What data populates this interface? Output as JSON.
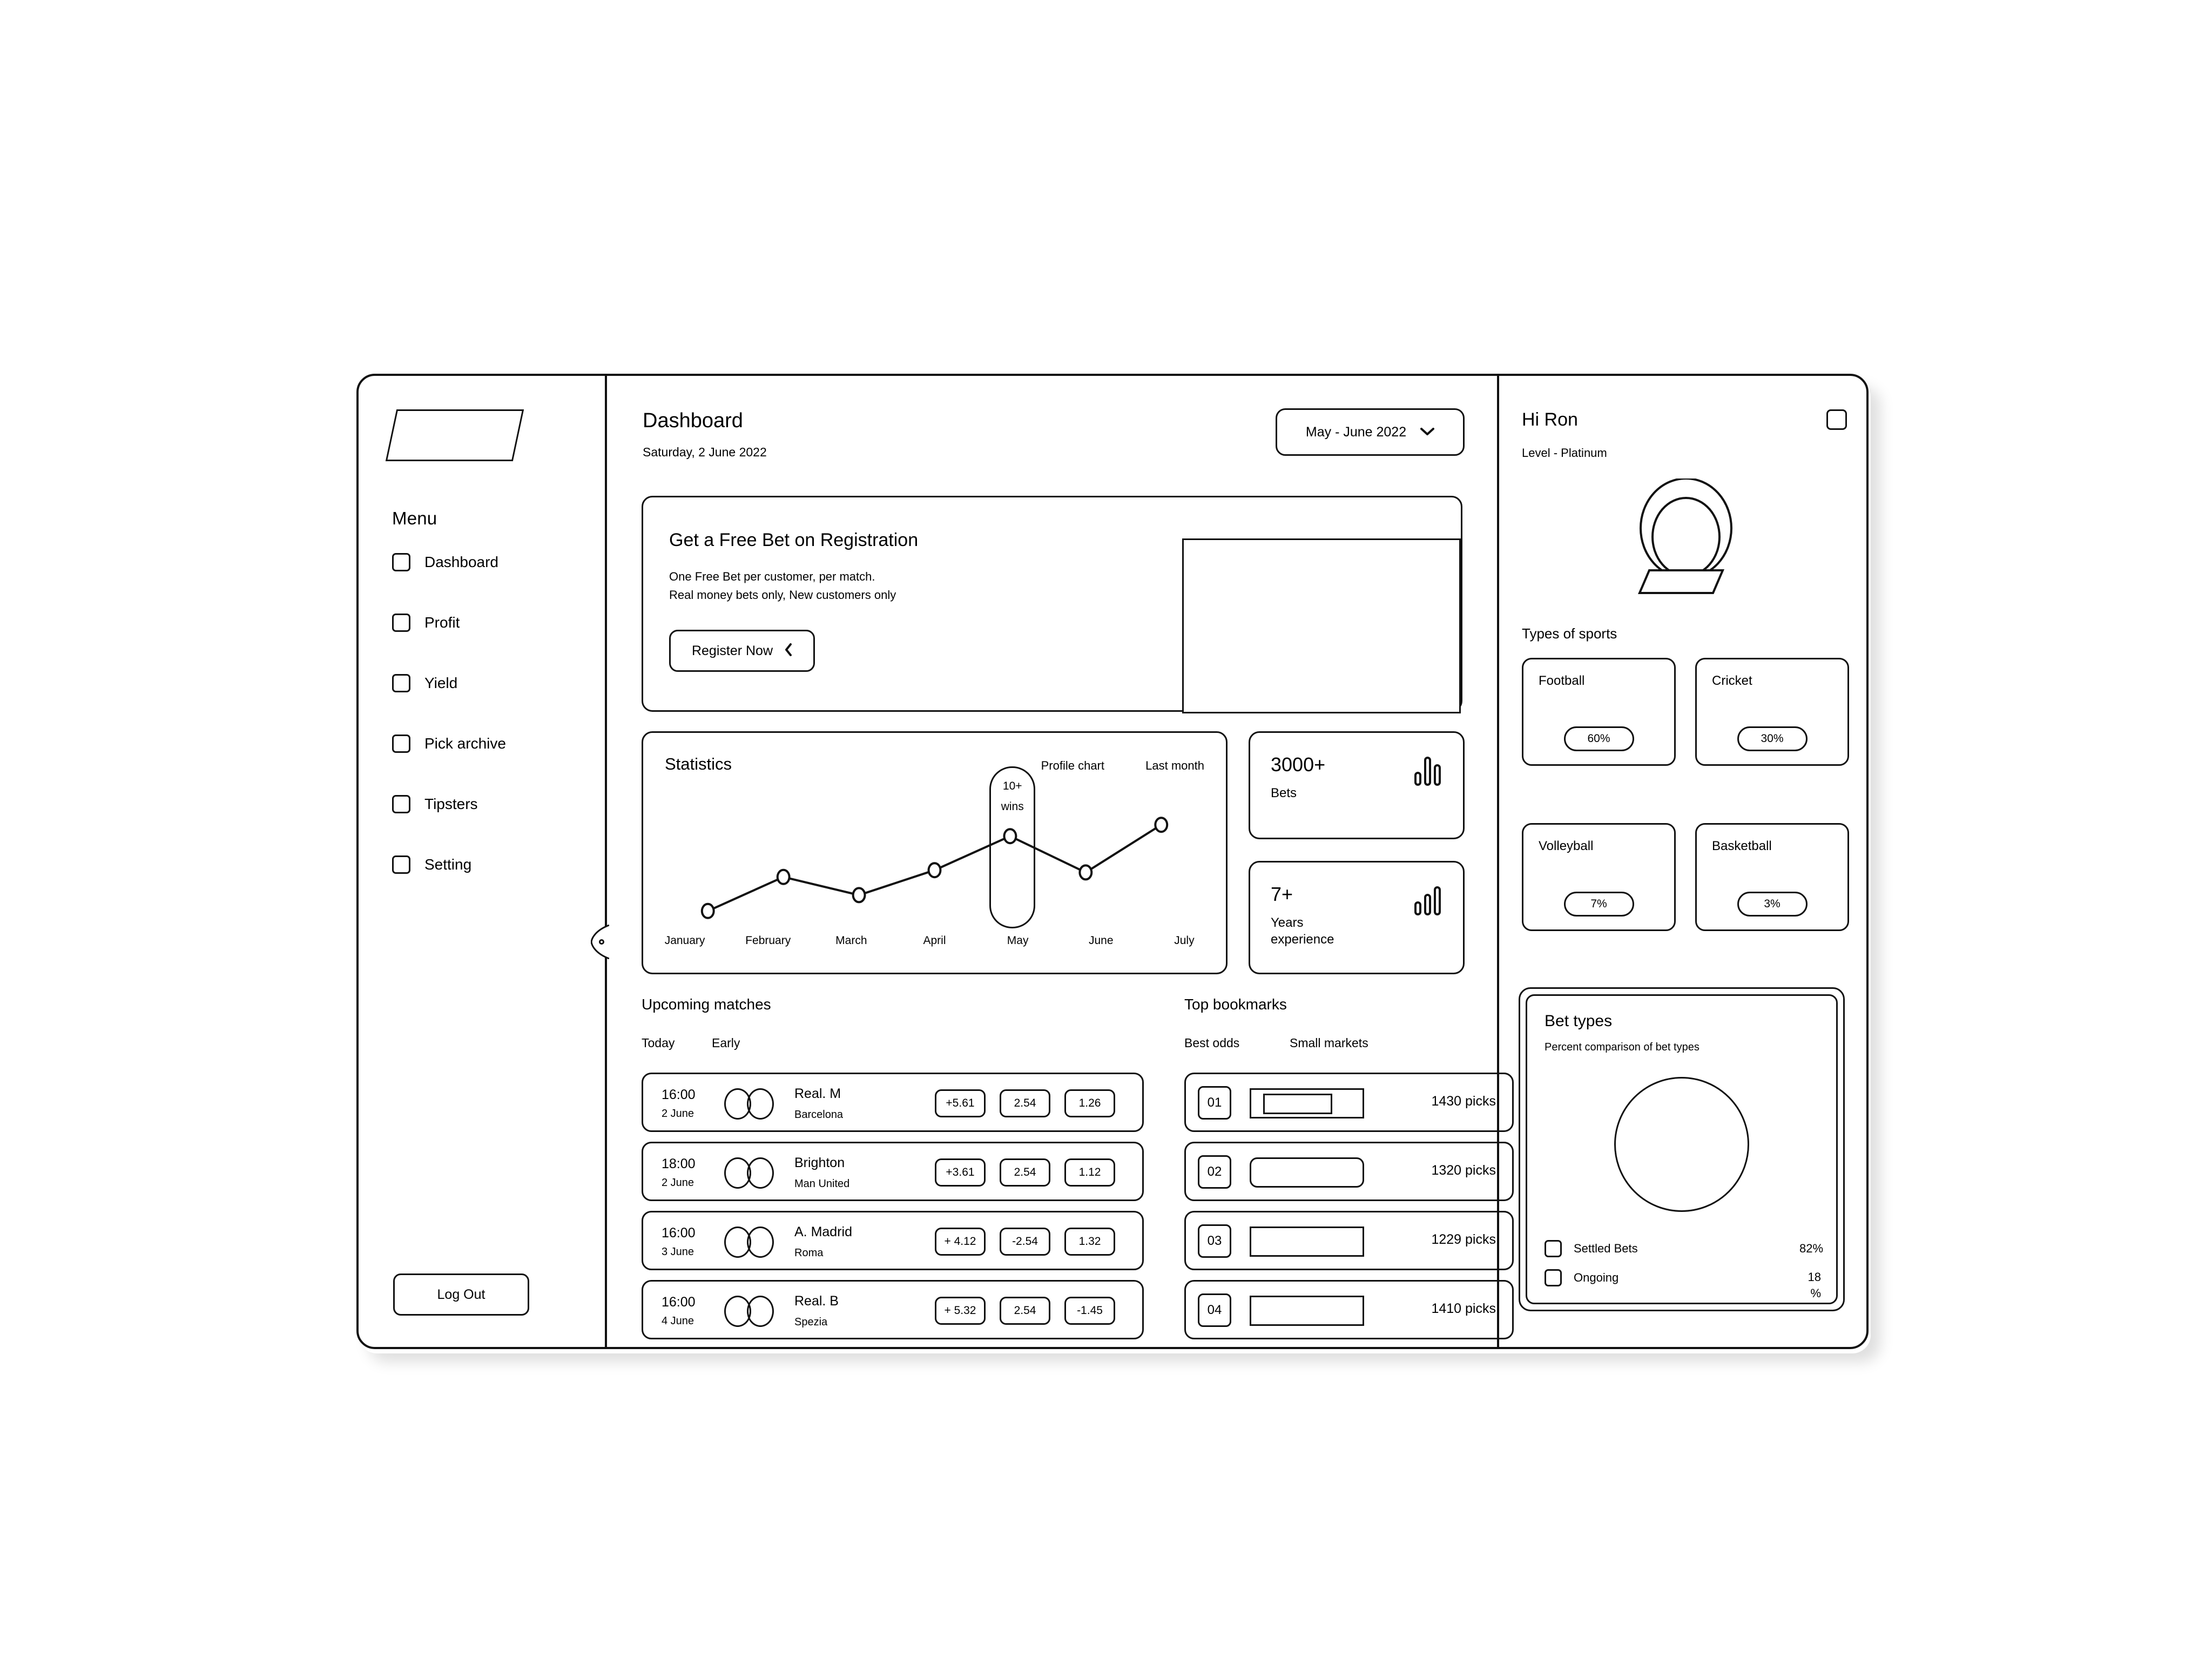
{
  "sidebar": {
    "logo_name": "brand-logo",
    "menu_title": "Menu",
    "items": [
      {
        "label": "Dashboard"
      },
      {
        "label": "Profit"
      },
      {
        "label": "Yield"
      },
      {
        "label": "Pick archive"
      },
      {
        "label": "Tipsters"
      },
      {
        "label": "Setting"
      }
    ],
    "logout_label": "Log Out"
  },
  "header": {
    "title": "Dashboard",
    "subtitle": "Saturday, 2 June 2022",
    "date_range": "May - June 2022",
    "chevron": "⌄"
  },
  "banner": {
    "heading": "Get a Free Bet on Registration",
    "line1": "One Free Bet per customer, per match.",
    "line2": "Real money bets only, New customers only",
    "button_label": "Register Now",
    "button_chevron": "❮"
  },
  "statistics": {
    "title": "Statistics",
    "tab1": "Profile chart",
    "tab2": "Last month",
    "highlight_line1": "10+",
    "highlight_line2": "wins"
  },
  "chart_data": {
    "type": "line",
    "title": "Statistics",
    "categories": [
      "January",
      "February",
      "March",
      "April",
      "May",
      "June",
      "July"
    ],
    "values": [
      12,
      42,
      26,
      48,
      78,
      46,
      88
    ],
    "ylim": [
      0,
      100
    ],
    "xlabel": "",
    "ylabel": "",
    "grid": false,
    "legend": "none",
    "annotation": "10+ wins",
    "annotation_category": "May",
    "tabs": [
      "Profile chart",
      "Last month"
    ]
  },
  "kpis": [
    {
      "value": "3000+",
      "label": "Bets",
      "icon": "bar-chart-icon"
    },
    {
      "value": "7+",
      "label": "Years\nexperience",
      "icon": "bar-chart-icon"
    }
  ],
  "matches": {
    "heading": "Upcoming matches",
    "tabs": [
      "Today",
      "Early"
    ],
    "rows": [
      {
        "time": "16:00",
        "date": "2 June",
        "team1": "Real. M",
        "team2": "Barcelona",
        "odd1": "+5.61",
        "odd2": "2.54",
        "odd3": "1.26"
      },
      {
        "time": "18:00",
        "date": "2 June",
        "team1": "Brighton",
        "team2": "Man United",
        "odd1": "+3.61",
        "odd2": "2.54",
        "odd3": "1.12"
      },
      {
        "time": "16:00",
        "date": "3 June",
        "team1": "A. Madrid",
        "team2": "Roma",
        "odd1": "+ 4.12",
        "odd2": "-2.54",
        "odd3": "1.32"
      },
      {
        "time": "16:00",
        "date": "4 June",
        "team1": "Real. B",
        "team2": "Spezia",
        "odd1": "+ 5.32",
        "odd2": "2.54",
        "odd3": "-1.45"
      }
    ]
  },
  "bookmarks": {
    "heading": "Top bookmarks",
    "tabs": [
      "Best odds",
      "Small markets"
    ],
    "rows": [
      {
        "rank": "01",
        "picks": "1430 picks"
      },
      {
        "rank": "02",
        "picks": "1320 picks"
      },
      {
        "rank": "03",
        "picks": "1229 picks"
      },
      {
        "rank": "04",
        "picks": "1410 picks"
      }
    ]
  },
  "profile": {
    "greeting": "Hi Ron",
    "level": "Level - Platinum",
    "avatar_name": "trophy-illustration",
    "notification_icon": "notification-checkbox-icon"
  },
  "sports": {
    "heading": "Types of sports",
    "cards": [
      {
        "name": "Football",
        "pct": "60%"
      },
      {
        "name": "Cricket",
        "pct": "30%"
      },
      {
        "name": "Volleyball",
        "pct": "7%"
      },
      {
        "name": "Basketball",
        "pct": "3%"
      }
    ]
  },
  "bet_types": {
    "title": "Bet types",
    "subtitle": "Percent comparison of bet types",
    "legend": [
      {
        "label": "Settled Bets",
        "value": "82%"
      },
      {
        "label": "Ongoing",
        "value": "18 %"
      }
    ]
  }
}
